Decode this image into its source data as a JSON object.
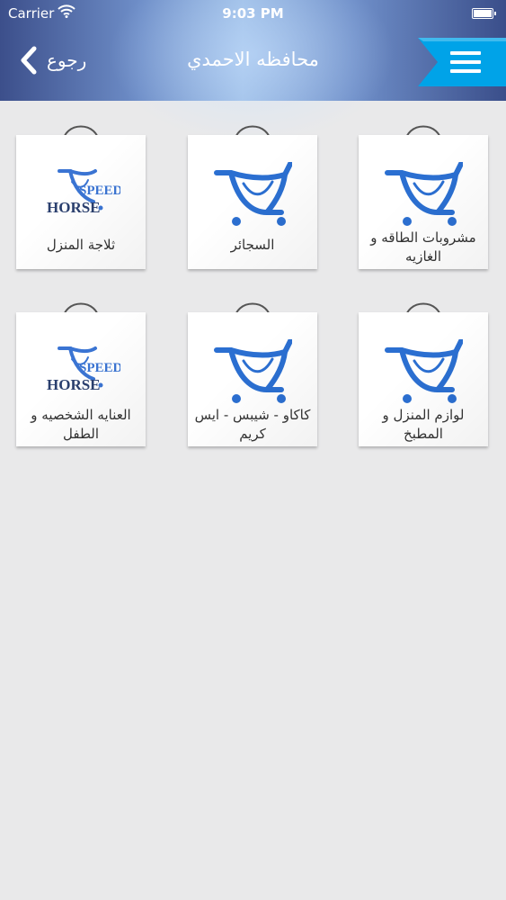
{
  "status": {
    "carrier": "Carrier",
    "time": "9:03 PM"
  },
  "nav": {
    "back_label": "رجوع",
    "title": "محافظه الاحمدي"
  },
  "brand": {
    "speed": "SPEED",
    "horse": "HORSE"
  },
  "colors": {
    "accent": "#00a3e8",
    "icon_blue": "#2b6fd1"
  },
  "categories": [
    {
      "label": "مشروبات الطاقه و الغازيه",
      "icon": "cart-icon"
    },
    {
      "label": "السجائر",
      "icon": "cart-icon"
    },
    {
      "label": "ثلاجة المنزل",
      "icon": "speed-horse-logo"
    },
    {
      "label": "لوازم المنزل و المطبخ",
      "icon": "cart-icon"
    },
    {
      "label": "كاكاو - شيبس - ايس كريم",
      "icon": "cart-icon"
    },
    {
      "label": "العنايه الشخصيه و الطفل",
      "icon": "speed-horse-logo"
    }
  ]
}
